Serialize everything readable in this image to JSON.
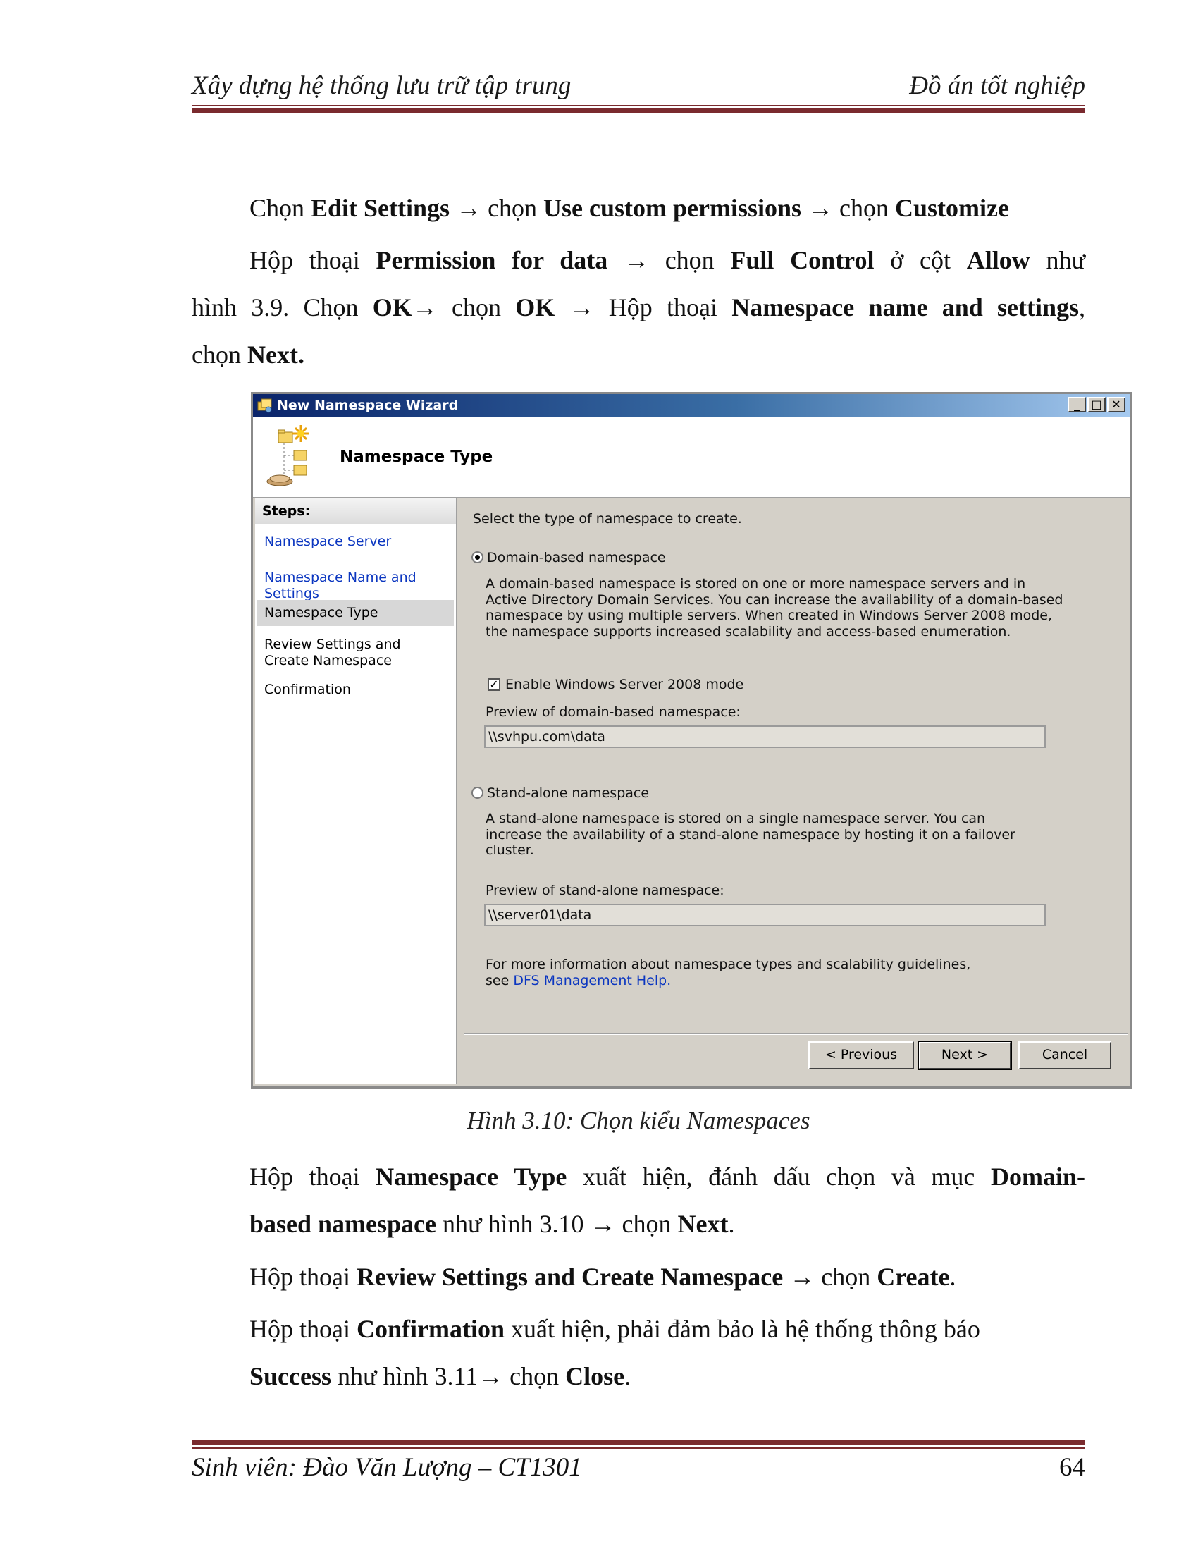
{
  "header": {
    "left": "Xây dựng hệ thống lưu trữ tập trung",
    "right": "Đồ án tốt nghiệp"
  },
  "body": {
    "p1": {
      "t1": "Chọn ",
      "b1": "Edit Settings",
      "t2": " → chọn ",
      "b2": "Use custom permissions",
      "t3": " → chọn ",
      "b3": "Customize"
    },
    "p2": {
      "t1": "Hộp thoại ",
      "b1": "Permission for data",
      "t2": " → chọn ",
      "b2": "Full Control",
      "t3": " ở cột ",
      "b3": "Allow",
      "t4": "  như",
      "l2_t1": "hình 3.9. Chọn ",
      "l2_b1": "OK",
      "l2_t2": "→ chọn ",
      "l2_b2": "OK",
      "l2_t3": " → Hộp thoại ",
      "l2_b3": "Namespace name and settings",
      "l2_t4": ",",
      "l3_t1": "chọn ",
      "l3_b1": "Next."
    },
    "caption": "Hình 3.10: Chọn kiểu Namespaces",
    "p3": {
      "t1": "Hộp thoại ",
      "b1": "Namespace Type",
      "t2": " xuất hiện, đánh dấu chọn và mục ",
      "b2": "Domain-",
      "l2_b1": "based namespace",
      "l2_t1": " như hình 3.10 → chọn ",
      "l2_b2": "Next",
      "l2_t2": "."
    },
    "p4": {
      "t1": "Hộp thoại ",
      "b1": "Review Settings and Create Namespace",
      "t2": " → chọn ",
      "b2": "Create",
      "t3": "."
    },
    "p5": {
      "t1": "Hộp thoại ",
      "b1": "Confirmation",
      "t2": " xuất hiện, phải đảm bảo là hệ thống thông báo",
      "l2_b1": "Success",
      "l2_t1": " như hình 3.11→ chọn ",
      "l2_b2": "Close",
      "l2_t2": "."
    }
  },
  "dialog": {
    "title": "New Namespace Wizard",
    "title_buttons": {
      "minimize": "_",
      "maximize": "□",
      "close": "✕"
    },
    "banner_title": "Namespace Type",
    "steps_header": "Steps:",
    "steps": [
      {
        "label": "Namespace Server",
        "state": "link"
      },
      {
        "label": "Namespace Name and Settings",
        "state": "link"
      },
      {
        "label": "Namespace Type",
        "state": "active"
      },
      {
        "label": "Review Settings and Create Namespace",
        "state": "pending"
      },
      {
        "label": "Confirmation",
        "state": "pending"
      }
    ],
    "instruction": "Select the type of namespace to create.",
    "domain_option": {
      "label": "Domain-based namespace",
      "selected": true,
      "description": "A domain-based namespace is stored on one or more namespace servers and in Active Directory Domain Services. You can increase the availability of a domain-based namespace by using multiple servers. When created in Windows Server 2008 mode, the namespace supports increased scalability and access-based enumeration.",
      "checkbox_label": "Enable Windows Server 2008 mode",
      "checkbox_checked": true,
      "preview_label": "Preview of domain-based namespace:",
      "preview_value": "\\\\svhpu.com\\data"
    },
    "standalone_option": {
      "label": "Stand-alone namespace",
      "selected": false,
      "description": "A stand-alone namespace is stored on a single namespace server. You can increase the availability of a stand-alone namespace by hosting it on a failover cluster.",
      "preview_label": "Preview of stand-alone namespace:",
      "preview_value": "\\\\server01\\data"
    },
    "help_text": "For more information about namespace types and scalability guidelines, see ",
    "help_link": "DFS Management Help.",
    "buttons": {
      "previous": "< Previous",
      "next": "Next >",
      "cancel": "Cancel"
    },
    "colors": {
      "title_bar": "#0a246a",
      "link": "#0b36c0",
      "panel": "#d4d0c8"
    }
  },
  "footer": {
    "left": "Sinh viên: Đào Văn Lượng – CT1301",
    "page": "64"
  },
  "colors": {
    "rule": "#7a2a2e"
  }
}
